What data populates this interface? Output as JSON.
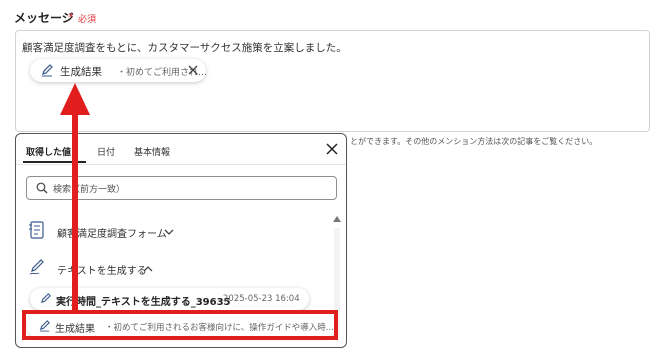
{
  "field": {
    "label": "メッセージ",
    "required_mark": "*",
    "required_text": "必須",
    "text": "顧客満足度調査をもとに、カスタマーサクセス施策を立案しました。",
    "chip": {
      "label": "生成結果",
      "preview": "・初めてご利用され…"
    },
    "help_text": "とができます。その他のメンション方法は次の記事をご覧ください。"
  },
  "panel": {
    "tabs": [
      {
        "label": "取得した値",
        "active": true
      },
      {
        "label": "日付",
        "active": false
      },
      {
        "label": "基本情報",
        "active": false
      }
    ],
    "search_placeholder": "検索（前方一致）",
    "sections": [
      {
        "label": "顧客満足度調査フォーム",
        "expanded": false,
        "icon": "form-icon"
      },
      {
        "label": "テキストを生成する",
        "expanded": true,
        "icon": "pen-icon"
      }
    ],
    "generated_item": {
      "title": "実行時間_テキストを生成する_39635",
      "date": "2025-05-23 16:04"
    },
    "result_row": {
      "label": "生成結果",
      "preview": "・初めてご利用されるお客様向けに、操作ガイドや導入時..."
    }
  },
  "annotation": {
    "highlight_color": "#e21d1d",
    "arrow_color": "#e21d1d"
  }
}
